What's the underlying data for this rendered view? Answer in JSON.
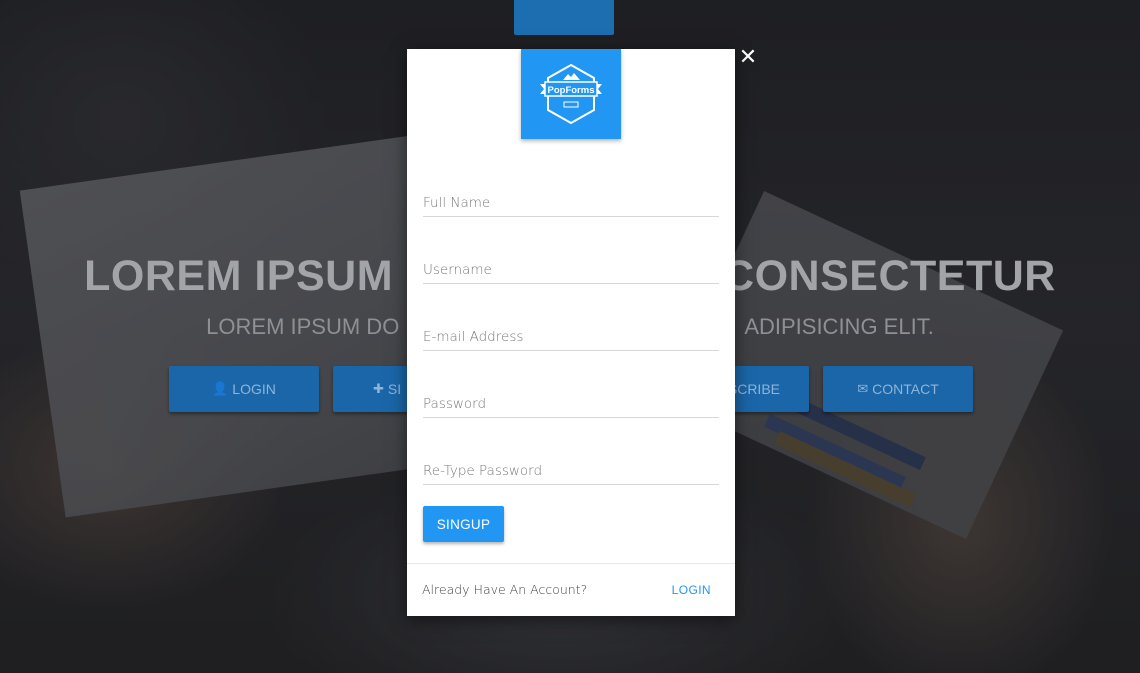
{
  "hero": {
    "title_left": "LOREM IPSUM",
    "title_right": "CONSECTETUR",
    "subtitle_left": "LOREM IPSUM DO",
    "subtitle_right": "ADIPISICING ELIT.",
    "buttons": [
      {
        "icon": "user-icon",
        "glyph": "👤",
        "label": "LOGIN"
      },
      {
        "icon": "user-plus-icon",
        "glyph": "✚",
        "label": "SI"
      },
      {
        "label": "SCRIBE"
      },
      {
        "icon": "envelope-icon",
        "glyph": "✉",
        "label": "CONTACT"
      }
    ]
  },
  "modal": {
    "close_glyph": "✕",
    "logo_text": "PopForms",
    "fields": [
      {
        "name": "full-name-field",
        "placeholder": "Full Name"
      },
      {
        "name": "username-field",
        "placeholder": "Username"
      },
      {
        "name": "email-field",
        "placeholder": "E-mail Address"
      },
      {
        "name": "password-field",
        "placeholder": "Password"
      },
      {
        "name": "retype-password-field",
        "placeholder": "Re-Type Password"
      }
    ],
    "submit_label": "SINGUP",
    "footer_text": "Already Have An Account?",
    "footer_link": "LOGIN"
  },
  "colors": {
    "accent": "#2196f3",
    "background_button": "#1a66a8"
  }
}
